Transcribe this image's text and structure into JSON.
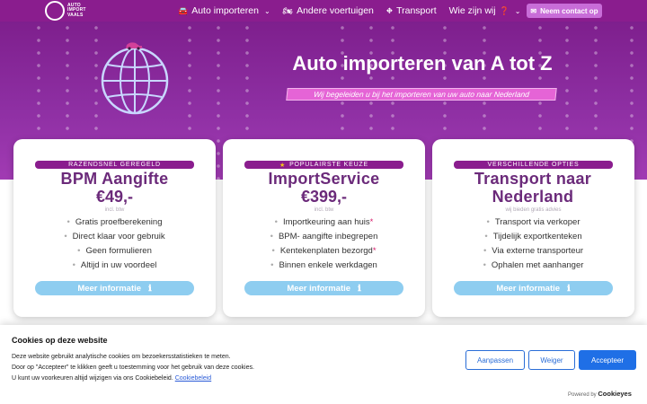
{
  "nav": {
    "logo_text": [
      "AUTO",
      "IMPORT",
      "VAALS"
    ],
    "items": [
      {
        "label": "Auto importeren",
        "icon": "car-icon",
        "glyph": "🚘",
        "has_dropdown": true
      },
      {
        "label": "Andere voertuigen",
        "icon": "motorcycle-icon",
        "glyph": "🏍",
        "has_dropdown": false
      },
      {
        "label": "Transport",
        "icon": "road-icon",
        "glyph": "⛖",
        "has_dropdown": false
      },
      {
        "label": "Wie zijn wij",
        "icon": "question-icon",
        "glyph": "❓",
        "has_dropdown": true
      }
    ],
    "contact_label": "Neem contact op"
  },
  "hero": {
    "title": "Auto importeren van A tot Z",
    "subtitle": "Wij begeleiden u bij het importeren van uw auto naar Nederland"
  },
  "cards": [
    {
      "tag": "RAZENDSNEL GEREGELD",
      "title": "BPM Aangifte",
      "price": "€49,-",
      "note": "incl. btw",
      "items": [
        "Gratis proefberekening",
        "Direct klaar voor gebruik",
        "Geen formulieren",
        "Altijd in uw voordeel"
      ],
      "more": "Meer informatie"
    },
    {
      "tag": "POPULAIRSTE KEUZE",
      "title": "ImportService",
      "price": "€399,-",
      "note": "incl. btw",
      "items": [
        "Importkeuring aan huis",
        "BPM- aangifte inbegrepen",
        "Kentekenplaten bezorgd",
        "Binnen enkele werkdagen"
      ],
      "more": "Meer informatie"
    },
    {
      "tag": "VERSCHILLENDE OPTIES",
      "title": "Transport naar Nederland",
      "price": "",
      "note": "wij bieden gratis advies",
      "items": [
        "Transport via verkoper",
        "Tijdelijk exportkenteken",
        "Via externe transporteur",
        "Ophalen met aanhanger"
      ],
      "more": "Meer informatie"
    }
  ],
  "cookie": {
    "title": "Cookies op deze website",
    "line1": "Deze website gebruikt analytische cookies om bezoekersstatistieken te meten.",
    "line2": "Door op \"Accepteer\" te klikken geeft u toestemming voor het gebruik van deze cookies.",
    "line3": "U kunt uw voorkeuren altijd wijzigen via ons Cookiebeleid.",
    "link": "Cookiebeleid",
    "btn_adjust": "Aanpassen",
    "btn_deny": "Weiger",
    "btn_accept": "Accepteer",
    "powered_by": "Powered by",
    "powered_brand": "Cookieyes"
  },
  "colors": {
    "nav": "#8a1d8e",
    "accent": "#6b2a7a",
    "button": "#8ecdf0",
    "accept": "#1f6fe6"
  }
}
